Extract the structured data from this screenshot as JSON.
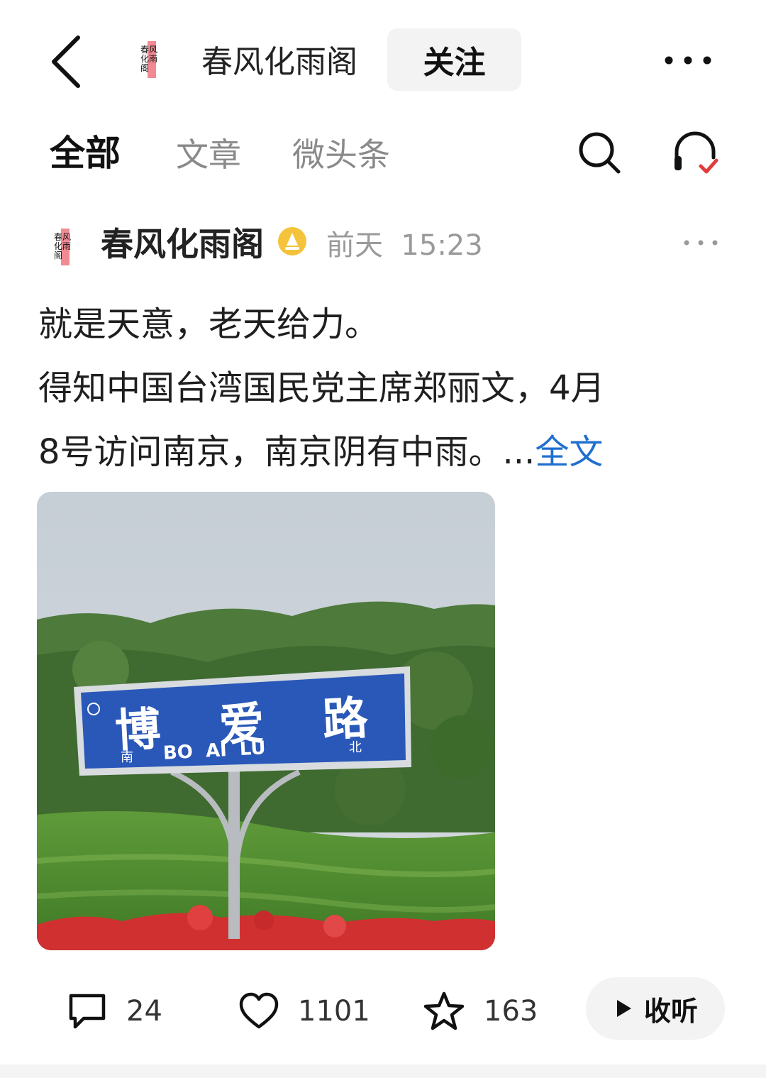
{
  "header": {
    "title": "春风化雨阁",
    "follow_label": "关注",
    "logo_text": "春风化雨阁"
  },
  "tabs": [
    {
      "label": "全部",
      "active": true
    },
    {
      "label": "文章",
      "active": false
    },
    {
      "label": "微头条",
      "active": false
    }
  ],
  "post": {
    "author": "春风化雨阁",
    "time": "前天  15:23",
    "lines": [
      "就是天意，老天给力。",
      "得知中国台湾国民党主席郑丽文，4月",
      "8号访问南京，南京阴有中雨。..."
    ],
    "fulltext_label": "全文",
    "image": {
      "sign_main": "博 爱 路",
      "sign_pinyin": "BO  AI  LU",
      "sign_left": "南",
      "sign_right": "北"
    }
  },
  "actions": {
    "comments": "24",
    "likes": "1101",
    "favorites": "163",
    "listen_label": "收听"
  },
  "colors": {
    "link": "#1f6fcf",
    "verified": "#f5c33b",
    "listen_check": "#e33b3b",
    "sign_blue": "#2a58b8"
  }
}
